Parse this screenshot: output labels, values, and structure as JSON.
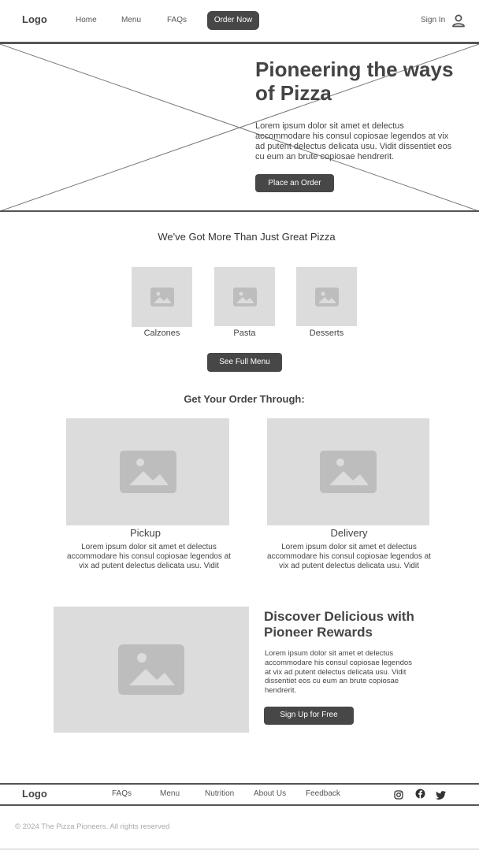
{
  "header": {
    "logo": "Logo",
    "nav": [
      "Home",
      "Menu",
      "FAQs"
    ],
    "order_button": "Order Now",
    "sign_in": "Sign In",
    "icons": {
      "account": "person-icon"
    }
  },
  "hero": {
    "title_line1": "Pioneering the ways",
    "title_line2": "of Pizza",
    "body": "Lorem ipsum dolor sit amet et delectus accommodare his consul copiosae legendos at vix ad putent delectus delicata usu. Vidit dissentiet eos cu eum an brute copiosae hendrerit.",
    "cta": "Place an Order"
  },
  "more": {
    "heading": "We've Got More Than Just Great Pizza",
    "items": [
      "Calzones",
      "Pasta",
      "Desserts"
    ],
    "cta": "See Full Menu"
  },
  "order_through": {
    "heading": "Get Your Order Through:",
    "options": [
      {
        "title": "Pickup",
        "body": "Lorem ipsum dolor sit amet et delectus accommodare his consul copiosae legendos at vix ad putent delectus delicata usu. Vidit"
      },
      {
        "title": "Delivery",
        "body": "Lorem ipsum dolor sit amet et delectus accommodare his consul copiosae legendos at vix ad putent delectus delicata usu. Vidit"
      }
    ]
  },
  "rewards": {
    "title_line1": "Discover Delicious with",
    "title_line2": "Pioneer Rewards",
    "body": "Lorem ipsum dolor sit amet et delectus accommodare his consul copiosae legendos at vix ad putent delectus delicata usu. Vidit dissentiet eos cu eum an brute copiosae hendrerit.",
    "cta": "Sign Up for Free"
  },
  "footer": {
    "logo": "Logo",
    "links": [
      "FAQs",
      "Menu",
      "Nutrition",
      "About Us",
      "Feedback"
    ],
    "social_icons": [
      "instagram-icon",
      "facebook-icon",
      "twitter-icon"
    ],
    "copyright": "© 2024 The Pizza Pioneers. All rights reserved"
  },
  "colors": {
    "button": "#474747",
    "placeholder": "#dcdcdc",
    "placeholder_icon": "#bdbdbd",
    "text": "#3d3d3d"
  }
}
